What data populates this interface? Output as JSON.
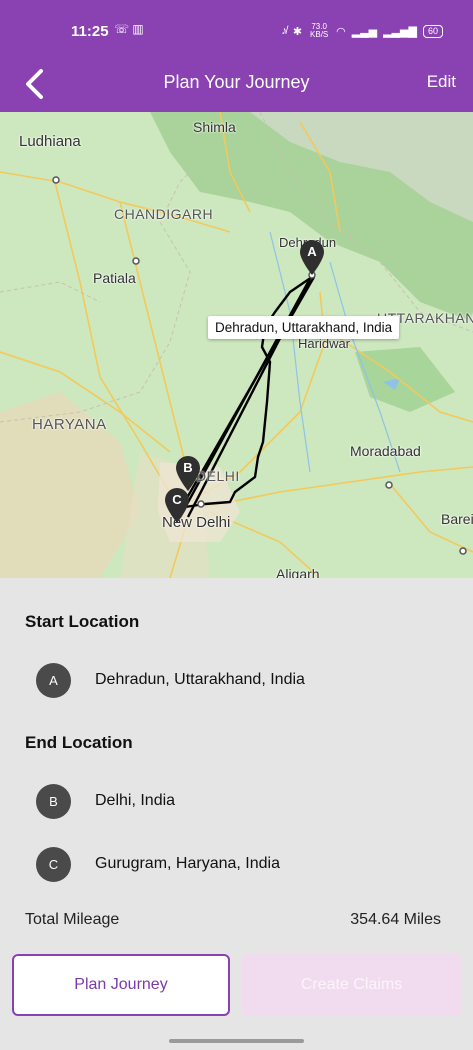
{
  "status_bar": {
    "time": "11:25",
    "left_icons": "☏ ▥",
    "net_speed": "73.0 KB/S",
    "battery": "60"
  },
  "header": {
    "title": "Plan Your Journey",
    "edit_label": "Edit",
    "back_icon": "chevron-left-icon"
  },
  "map": {
    "labels": {
      "shimla": "Shimla",
      "ludhiana": "Ludhiana",
      "chandigarh": "CHANDIGARH",
      "dehradun": "Dehradun",
      "patiala": "Patiala",
      "uttarakhand": "UTTARAKHAND",
      "haridwar": "Haridwar",
      "haryana": "HARYANA",
      "moradabad": "Moradabad",
      "delhi": "DELHI",
      "new_delhi": "New Delhi",
      "bareilly": "Barei",
      "aligarh": "Aligarh"
    },
    "tooltip": "Dehradun, Uttarakhand, India",
    "pins": {
      "a": "A",
      "b": "B",
      "c": "C"
    }
  },
  "start": {
    "heading": "Start Location",
    "items": [
      {
        "badge": "A",
        "text": "Dehradun, Uttarakhand, India"
      }
    ]
  },
  "end": {
    "heading": "End Location",
    "items": [
      {
        "badge": "B",
        "text": "Delhi, India"
      },
      {
        "badge": "C",
        "text": "Gurugram, Haryana, India"
      }
    ]
  },
  "mileage": {
    "label": "Total Mileage",
    "value": "354.64 Miles"
  },
  "actions": {
    "plan": "Plan Journey",
    "claims": "Create Claims"
  },
  "colors": {
    "primary": "#8a41b2",
    "disabled_button": "#f1dcef",
    "badge": "#4a4a4a"
  }
}
